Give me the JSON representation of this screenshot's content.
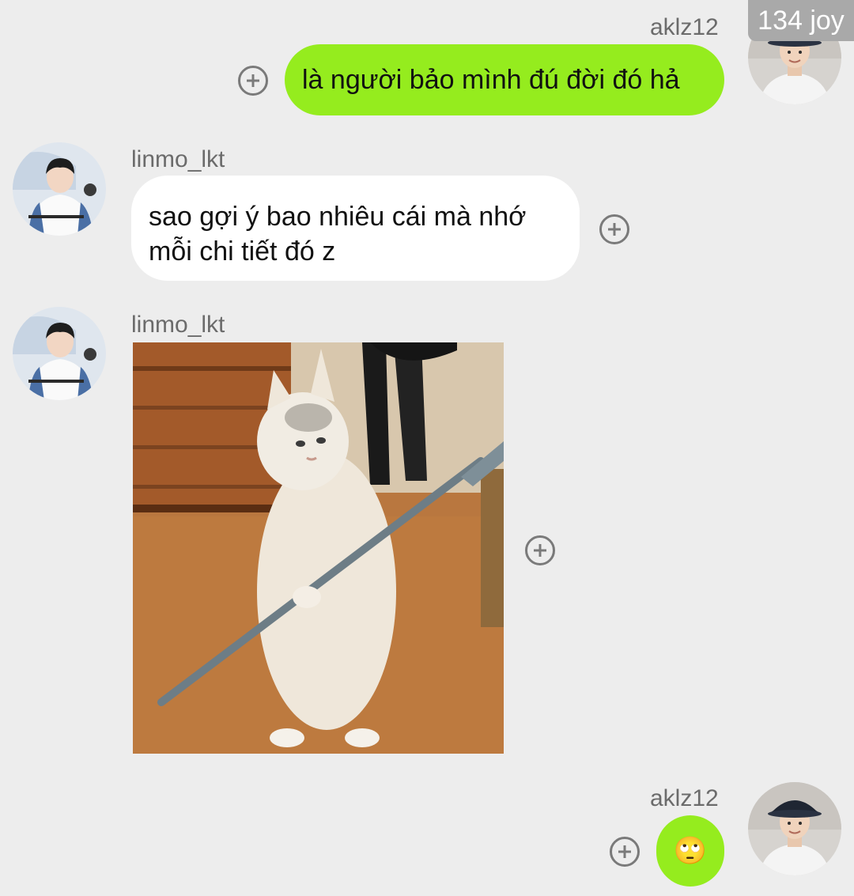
{
  "watermark": "134 joy",
  "messages": [
    {
      "sender": "aklz12",
      "side": "right",
      "text": "là người bảo mình đú đời đó hả"
    },
    {
      "sender": "linmo_lkt",
      "side": "left",
      "line1": "sao gợi ý bao nhiêu cái mà nhớ",
      "line2": "mỗi chi tiết đó z"
    },
    {
      "sender": "linmo_lkt",
      "side": "left",
      "image": "cat-standing-with-spear-photo"
    },
    {
      "sender": "aklz12",
      "side": "right",
      "emoji": "🙄"
    }
  ],
  "colors": {
    "background": "#ededed",
    "green_bubble": "#95ec1e",
    "white_bubble": "#ffffff",
    "username": "#6b6b6b"
  },
  "icons": [
    "add-circle-icon"
  ]
}
